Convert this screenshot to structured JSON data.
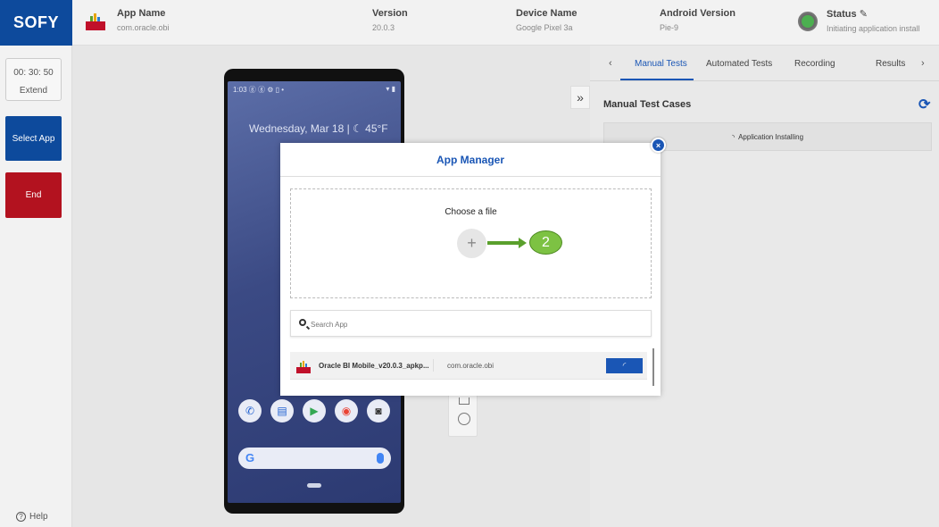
{
  "header": {
    "logo": "SOFY",
    "app_name_label": "App Name",
    "app_name_value": "com.oracle.obi",
    "version_label": "Version",
    "version_value": "20.0.3",
    "device_label": "Device Name",
    "device_value": "Google Pixel 3a",
    "android_label": "Android Version",
    "android_value": "Pie-9",
    "status_label": "Status",
    "status_value": "Initiating application install",
    "status_color": "#4caf50"
  },
  "sidebar": {
    "timer": "00: 30: 50",
    "extend_label": "Extend",
    "select_app_label": "Select App",
    "end_label": "End",
    "help_label": "Help"
  },
  "phone": {
    "status_time": "1:03",
    "date_text": "Wednesday, Mar 18 | ☾ 45°F"
  },
  "right_panel": {
    "tabs": [
      "Manual Tests",
      "Automated Tests",
      "Recording",
      "Results"
    ],
    "active_tab": "Manual Tests",
    "section_title": "Manual Test Cases",
    "installing_text": "Application Installing"
  },
  "modal": {
    "title": "App Manager",
    "choose_file_label": "Choose a file",
    "step_number": "2",
    "search_placeholder": "Search App",
    "apps": [
      {
        "name": "Oracle BI Mobile_v20.0.3_apkp...",
        "package": "com.oracle.obi"
      }
    ]
  },
  "colors": {
    "brand": "#0d4a9c",
    "accent": "#1a56b5",
    "end": "#b3121f",
    "step_badge": "#7dc243"
  }
}
